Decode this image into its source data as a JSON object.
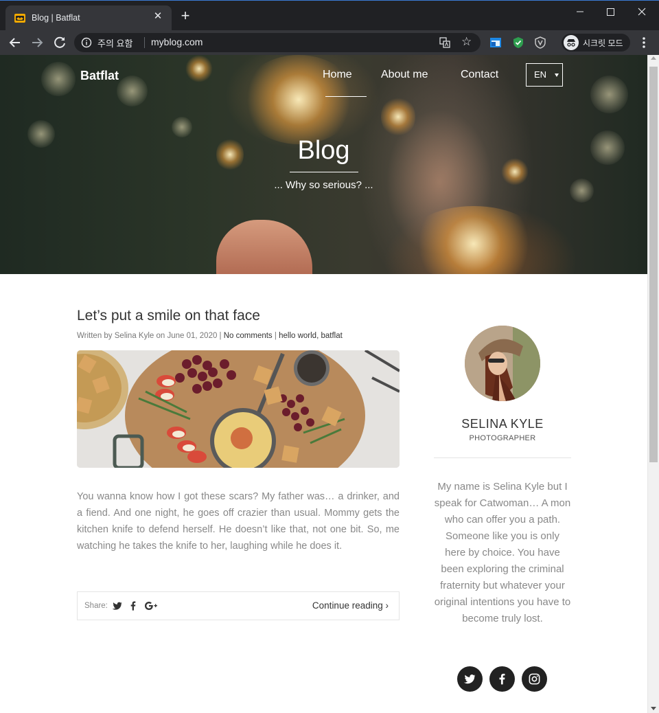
{
  "browser": {
    "tab_title": "Blog | Batflat",
    "new_tab_label": "+",
    "close_tab_label": "✕",
    "security_label": "주의 요함",
    "url": "myblog.com",
    "incognito_label": "시크릿 모드"
  },
  "site": {
    "brand": "Batflat",
    "nav": [
      {
        "label": "Home",
        "active": true
      },
      {
        "label": "About me",
        "active": false
      },
      {
        "label": "Contact",
        "active": false
      }
    ],
    "language": "EN"
  },
  "hero": {
    "title": "Blog",
    "subtitle": "... Why so serious? ..."
  },
  "post": {
    "title": "Let’s put a smile on that face",
    "meta": {
      "written_by": "Written by Selina Kyle on June 01, 2020 |",
      "comments": "No comments",
      "separator": "|",
      "tags": "hello world, batflat"
    },
    "body": "You wanna know how I got these scars? My father was… a drinker, and a fiend. And one night, he goes off crazier than usual. Mommy gets the kitchen knife to defend herself. He doesn’t like that, not one bit. So, me watching he takes the knife to her, laughing while he does it.",
    "share_label": "Share:",
    "continue_label": "Continue reading ›"
  },
  "author": {
    "name": "SELINA KYLE",
    "role": "PHOTOGRAPHER",
    "bio": "My name is Selina Kyle but I speak for Catwoman… A mon who can offer you a path. Someone like you is only here by choice. You have been exploring the criminal fraternity but whatever your original intentions you have to become truly lost."
  },
  "social_icons": [
    "twitter-icon",
    "facebook-icon",
    "instagram-icon"
  ],
  "colors": {
    "chrome_dark": "#202124",
    "chrome_tab": "#35363a",
    "text_dark": "#333333",
    "text_muted": "#888888",
    "social_bg": "#222222"
  }
}
